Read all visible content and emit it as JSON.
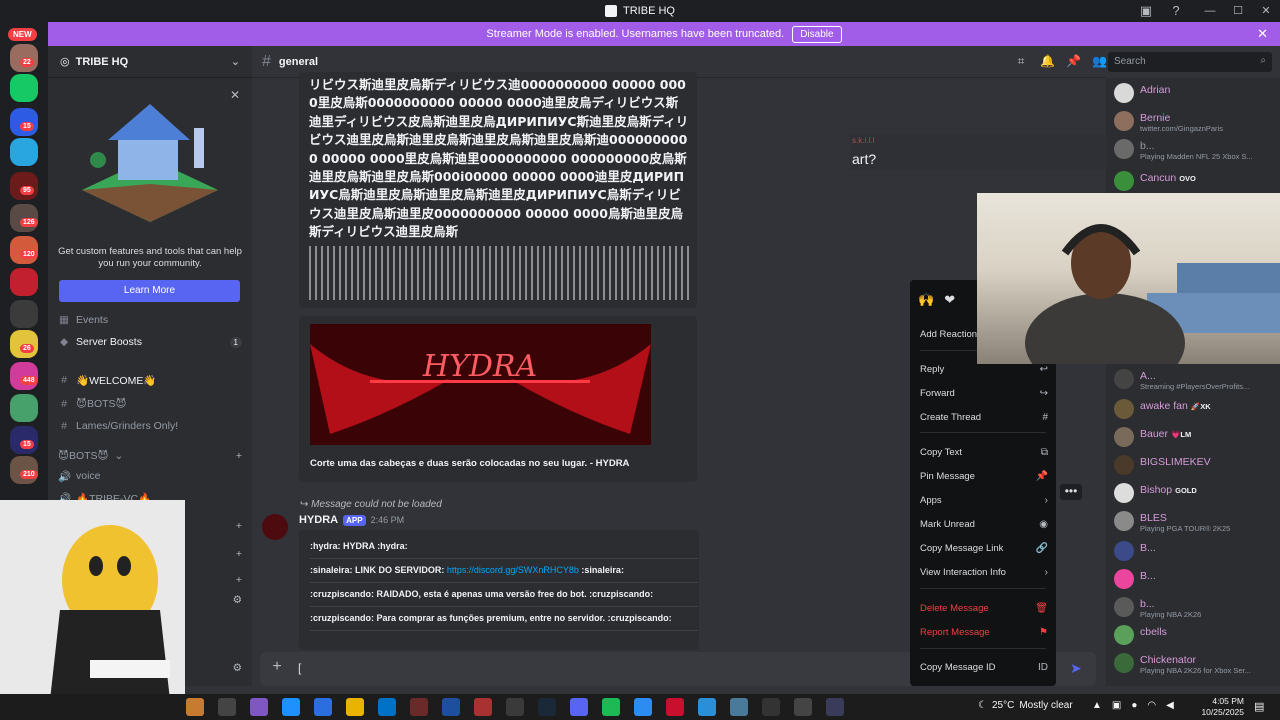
{
  "window": {
    "title": "TRIBE HQ",
    "controls": [
      "—",
      "☐",
      "✕"
    ]
  },
  "banner": {
    "text": "Streamer Mode is enabled. Usernames have been truncated.",
    "disable_label": "Disable"
  },
  "rail": {
    "new_label": "NEW",
    "counts": [
      "22",
      "15",
      "95",
      "126",
      "120",
      "26",
      "448",
      "15",
      "210"
    ]
  },
  "sidebar": {
    "server_name": "TRIBE HQ",
    "promo_text": "Get custom features and tools that can help you run your community.",
    "learn_more": "Learn More",
    "events": "Events",
    "server_boosts": "Server Boosts",
    "boost_count": "1",
    "channels": {
      "welcome": "👋WELCOME👋",
      "bots": "😈BOTS😈",
      "lames": "Lames/Grinders Only!",
      "bots_category": "😈BOTS😈",
      "voice": "voice",
      "tribe_vc": "🔥TRIBE-VC🔥"
    }
  },
  "chat": {
    "channel_name": "general",
    "search_placeholder": "Search",
    "garbled_text": "リビウス斯迪里皮烏斯ディリビウス迪0000000000 00000 0000里皮烏斯0000000000 00000 0000迪里皮烏ディリビウス斯迪里ディリビウス皮烏斯迪里皮烏ДИРИПИУС斯迪里皮烏斯ディリビウス迪里皮烏斯迪里皮烏斯迪里皮烏斯迪里皮烏斯迪0000000000 00000 0000里皮烏斯迪里0000000000 000000000皮烏斯迪里皮烏斯迪里皮烏斯000i00000 00000 0000迪里皮ДИРИПИУС烏斯迪里皮烏斯迪里皮烏斯迪里皮ДИРИПИУС烏斯ディリビウス迪里皮烏斯迪里皮0000000000 00000 0000烏斯迪里皮烏斯ディリビウス迪里皮烏斯",
    "image_caption": "Corte uma das cabeças e duas serão colocadas no seu lugar. - HYDRA",
    "reply_notice": "Message could not be loaded",
    "author": "HYDRA",
    "app_tag": "APP",
    "time": "2:46 PM",
    "embed_lines": [
      ":hydra: HYDRA :hydra:",
      ":sinaleira: LINK DO SERVIDOR: ",
      ":cruzpiscando: RAIDADO, esta é apenas uma versão free do bot. :cruzpiscando:",
      ":cruzpiscando: Para comprar as funções premium, entre no servidor. :cruzpiscando:"
    ],
    "embed_link": "https://discord.gg/SWXnRHCY8b",
    "embed_link_suffix": " :sinaleira:",
    "art_author": "s.k.i.l.l",
    "art_text": "art?",
    "input_value": "["
  },
  "context_menu": {
    "add_reaction": "Add Reaction",
    "items": [
      {
        "label": "Reply",
        "icon": "↩"
      },
      {
        "label": "Forward",
        "icon": "↪"
      },
      {
        "label": "Create Thread",
        "icon": "#"
      },
      {
        "label": "Copy Text",
        "icon": "⧉"
      },
      {
        "label": "Pin Message",
        "icon": "📌"
      },
      {
        "label": "Apps",
        "icon": "›"
      },
      {
        "label": "Mark Unread",
        "icon": "◉"
      },
      {
        "label": "Copy Message Link",
        "icon": "🔗"
      },
      {
        "label": "View Interaction Info",
        "icon": "›"
      },
      {
        "label": "Delete Message",
        "icon": "🗑"
      },
      {
        "label": "Report Message",
        "icon": "⚑"
      },
      {
        "label": "Copy Message ID",
        "icon": "ID"
      }
    ]
  },
  "members": [
    {
      "name": "Adrian",
      "sub": "",
      "color": "#d59bd8"
    },
    {
      "name": "Bernie",
      "sub": "twitter.com/GingaznParis",
      "color": "#d59bd8"
    },
    {
      "name": "b...",
      "sub": "Playing Madden NFL 25 Xbox S...",
      "color": "#949ba4"
    },
    {
      "name": "Cancun",
      "sub": "",
      "tag": "OVO",
      "color": "#d59bd8"
    },
    {
      "name": "A...",
      "sub": "Streaming #PlayersOverProfits...",
      "color": "#d59bd8"
    },
    {
      "name": "awake fan",
      "sub": "",
      "tag": "🚀XK",
      "color": "#d59bd8"
    },
    {
      "name": "Bauer",
      "sub": "",
      "tag": "💗LM",
      "color": "#d59bd8"
    },
    {
      "name": "BIGSLIMEKEV",
      "sub": "",
      "color": "#d59bd8"
    },
    {
      "name": "Bishop",
      "sub": "",
      "tag": "GOLD",
      "color": "#d59bd8"
    },
    {
      "name": "BLES",
      "sub": "Playing PGA TOUR® 2K25",
      "color": "#d59bd8"
    },
    {
      "name": "B...",
      "sub": "",
      "color": "#d59bd8"
    },
    {
      "name": "B...",
      "sub": "",
      "color": "#d59bd8"
    },
    {
      "name": "b...",
      "sub": "Playing NBA 2K26",
      "color": "#d59bd8"
    },
    {
      "name": "cbells",
      "sub": "",
      "color": "#d59bd8"
    },
    {
      "name": "Chickenator",
      "sub": "Playing NBA 2K26 for Xbox Ser...",
      "color": "#d59bd8"
    }
  ],
  "taskbar": {
    "weather_temp": "25°C",
    "weather_text": "Mostly clear",
    "time": "4:05 PM",
    "date": "10/25/2025"
  },
  "colors": {
    "accent": "#5865f2",
    "streamer_banner": "#a15ce8",
    "danger": "#f23f43"
  }
}
